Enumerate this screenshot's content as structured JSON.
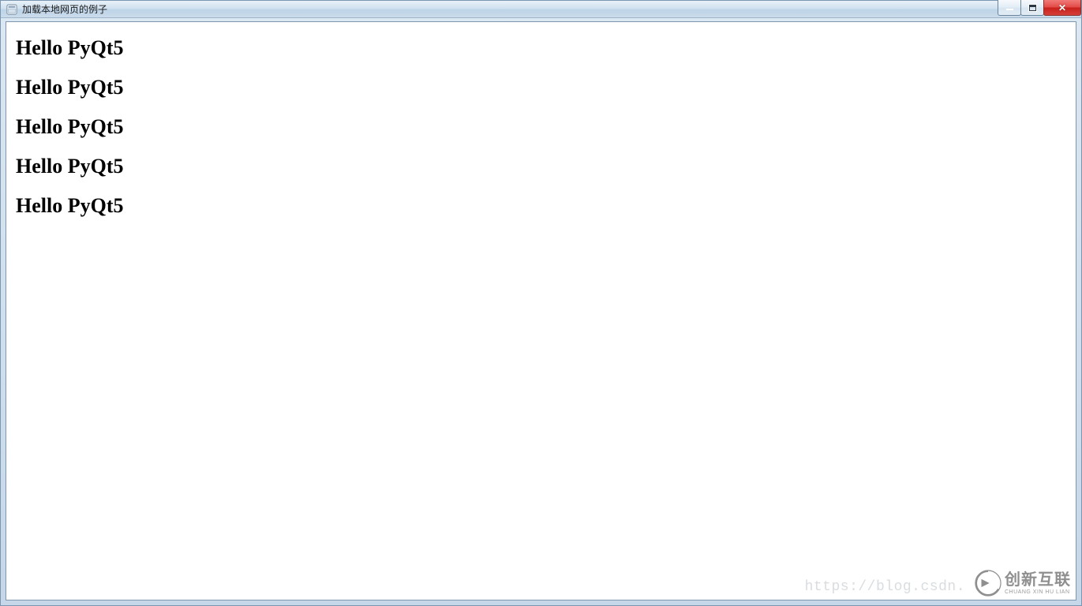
{
  "window": {
    "title": "加载本地网页的例子"
  },
  "content": {
    "headings": [
      "Hello PyQt5",
      "Hello PyQt5",
      "Hello PyQt5",
      "Hello PyQt5",
      "Hello PyQt5"
    ]
  },
  "watermark": {
    "url": "https://blog.csdn.",
    "brand_zh": "创新互联",
    "brand_en": "CHUANG XIN HU LIAN"
  }
}
